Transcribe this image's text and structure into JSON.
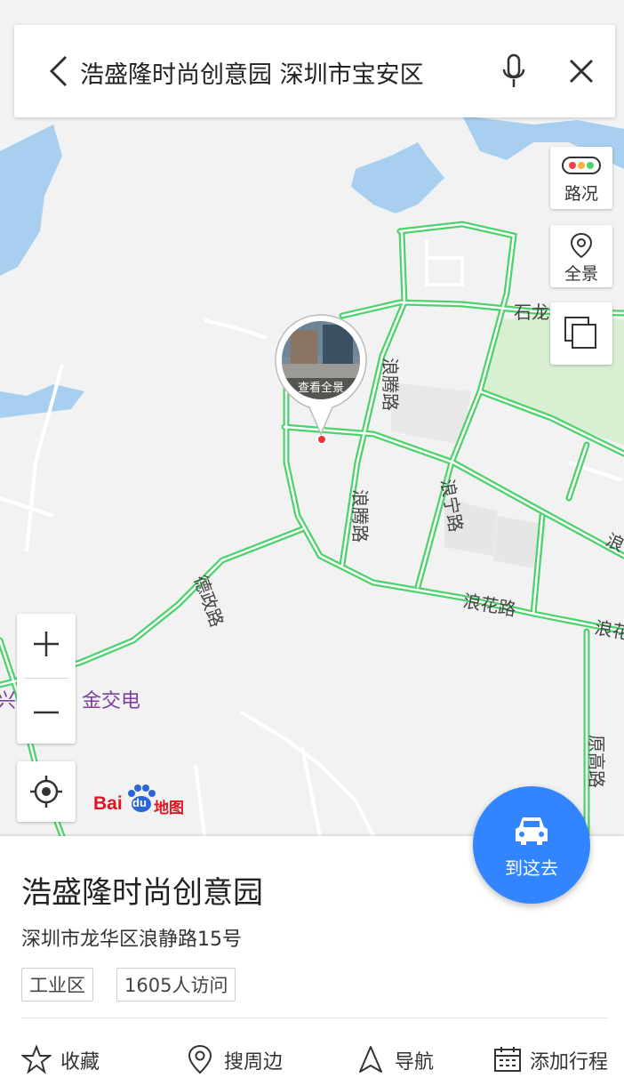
{
  "search": {
    "query": "浩盛隆时尚创意园 深圳市宝安区"
  },
  "map": {
    "road_labels": {
      "shilong": "石龙仔路",
      "langteng1": "浪腾路",
      "langteng2": "浪腾路",
      "langning": "浪宁路",
      "langhua": "浪花路",
      "desheng": "德政路",
      "yuangao": "原高路",
      "lang_right1": "浪",
      "lang_right2": "浪花"
    },
    "poi_label": "金交电",
    "poi_label_left": "兴",
    "panorama_label": "查看全景",
    "controls": {
      "traffic_label": "路况",
      "panorama_label": "全景"
    },
    "logo": {
      "bai": "Bai",
      "du": "du",
      "ditu": "地图"
    },
    "colors": {
      "road": "#4cd26b",
      "water": "#a8cff0",
      "green": "#d9efd2",
      "accent": "#3385ff"
    }
  },
  "go_button": {
    "label": "到这去",
    "icon": "car-icon"
  },
  "place": {
    "name": "浩盛隆时尚创意园",
    "address": "深圳市龙华区浪静路15号",
    "tags": [
      "工业区",
      "1605人访问"
    ]
  },
  "actions": [
    {
      "label": "收藏",
      "icon": "star-icon"
    },
    {
      "label": "搜周边",
      "icon": "location-pin-icon"
    },
    {
      "label": "导航",
      "icon": "navigation-arrow-icon"
    },
    {
      "label": "添加行程",
      "icon": "calendar-icon"
    }
  ]
}
